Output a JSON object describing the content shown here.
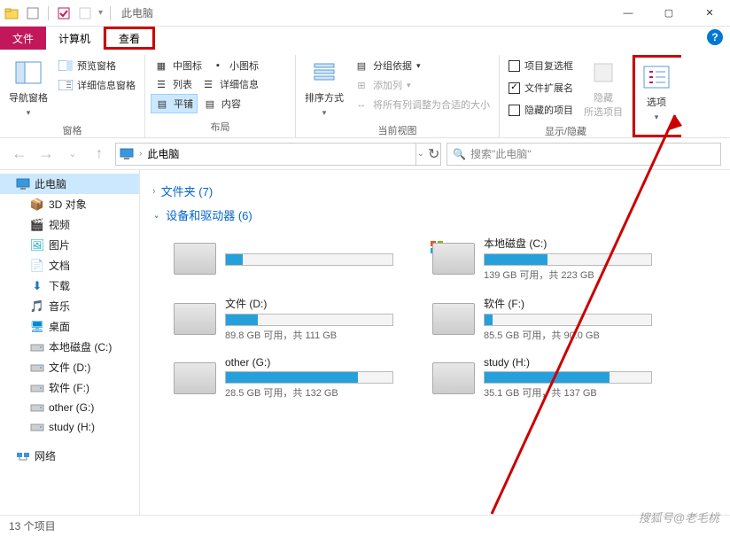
{
  "title": "此电脑",
  "tabs": {
    "file": "文件",
    "computer": "计算机",
    "view": "查看"
  },
  "ribbon": {
    "panes": {
      "label": "窗格",
      "nav": "导航窗格",
      "preview": "预览窗格",
      "details": "详细信息窗格"
    },
    "layout": {
      "label": "布局",
      "medium": "中图标",
      "small": "小图标",
      "list": "列表",
      "details_v": "详细信息",
      "tiles": "平铺",
      "content": "内容"
    },
    "current": {
      "label": "当前视图",
      "sort": "排序方式",
      "group": "分组依据",
      "addcol": "添加列",
      "fitcols": "将所有列调整为合适的大小"
    },
    "showhide": {
      "label": "显示/隐藏",
      "itemcheck": "项目复选框",
      "ext": "文件扩展名",
      "hidden": "隐藏的项目",
      "hidesel": "隐藏\n所选项目"
    },
    "options": "选项"
  },
  "breadcrumb": "此电脑",
  "search_placeholder": "搜索\"此电脑\"",
  "sidebar": {
    "this_pc": "此电脑",
    "items": [
      {
        "label": "3D 对象"
      },
      {
        "label": "视频"
      },
      {
        "label": "图片"
      },
      {
        "label": "文档"
      },
      {
        "label": "下载"
      },
      {
        "label": "音乐"
      },
      {
        "label": "桌面"
      },
      {
        "label": "本地磁盘 (C:)"
      },
      {
        "label": "文件 (D:)"
      },
      {
        "label": "软件 (F:)"
      },
      {
        "label": "other  (G:)"
      },
      {
        "label": "study (H:)"
      }
    ],
    "network": "网络"
  },
  "content": {
    "folders_header": "文件夹 (7)",
    "drives_header": "设备和驱动器 (6)",
    "drives": [
      {
        "name": "",
        "info": "",
        "fill": 10,
        "blur": true
      },
      {
        "name": "本地磁盘 (C:)",
        "info": "139 GB 可用，共 223 GB",
        "fill": 38,
        "win": true
      },
      {
        "name": "文件 (D:)",
        "info": "89.8 GB 可用，共 111 GB",
        "fill": 19
      },
      {
        "name": "软件 (F:)",
        "info": "85.5 GB 可用，共 90.0 GB",
        "fill": 5
      },
      {
        "name": "other  (G:)",
        "info": "28.5 GB 可用，共 132 GB",
        "fill": 79
      },
      {
        "name": "study (H:)",
        "info": "35.1 GB 可用，共 137 GB",
        "fill": 75
      }
    ]
  },
  "status": "13 个项目",
  "watermark": "搜狐号@老毛桃"
}
